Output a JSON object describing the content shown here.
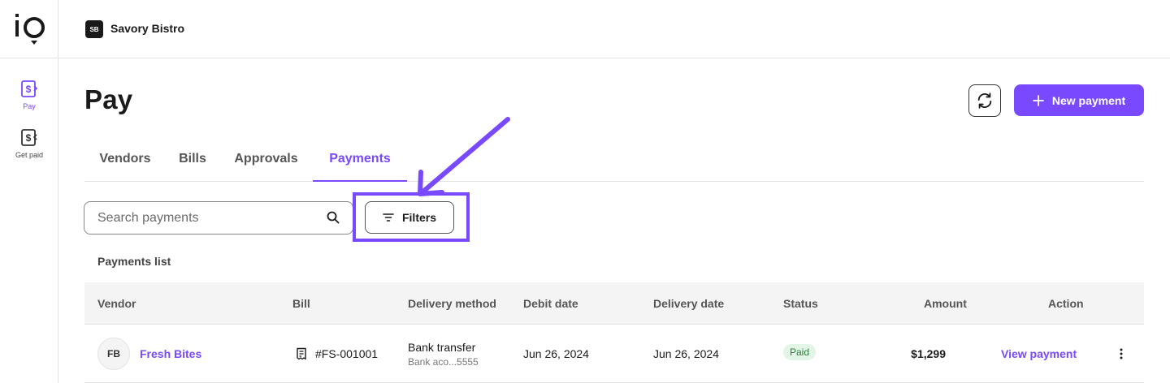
{
  "sidebar": {
    "items": [
      {
        "label": "Pay",
        "icon": "dollar-document-icon",
        "active": true
      },
      {
        "label": "Get paid",
        "icon": "dollar-document-icon",
        "active": false
      }
    ]
  },
  "org": {
    "badge": "SB",
    "name": "Savory Bistro"
  },
  "header": {
    "title": "Pay",
    "new_payment_label": "New payment"
  },
  "tabs": [
    {
      "label": "Vendors",
      "active": false
    },
    {
      "label": "Bills",
      "active": false
    },
    {
      "label": "Approvals",
      "active": false
    },
    {
      "label": "Payments",
      "active": true
    }
  ],
  "search": {
    "placeholder": "Search payments",
    "value": ""
  },
  "filters": {
    "label": "Filters"
  },
  "list": {
    "title": "Payments list",
    "columns": [
      "Vendor",
      "Bill",
      "Delivery method",
      "Debit date",
      "Delivery date",
      "Status",
      "Amount",
      "Action"
    ],
    "rows": [
      {
        "avatar": "FB",
        "vendor": "Fresh Bites",
        "bill": "#FS-001001",
        "delivery_method": "Bank transfer",
        "delivery_detail": "Bank aco...5555",
        "debit_date": "Jun 26, 2024",
        "delivery_date": "Jun 26, 2024",
        "status": "Paid",
        "amount": "$1,299",
        "action": "View payment"
      }
    ]
  },
  "colors": {
    "accent": "#7849ff",
    "paid_bg": "#e3f5e6",
    "paid_text": "#2d7a3a",
    "header_bg": "#f4f4f5"
  }
}
